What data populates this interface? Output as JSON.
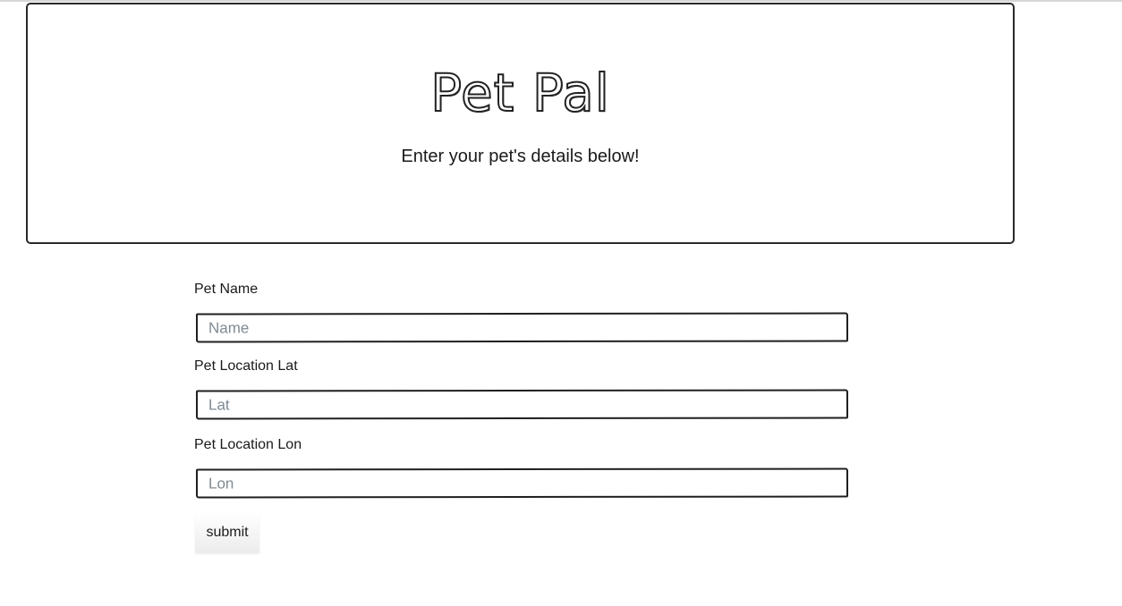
{
  "header": {
    "title": "Pet Pal",
    "subtitle": "Enter your pet's details below!"
  },
  "form": {
    "name": {
      "label": "Pet Name",
      "placeholder": "Name",
      "value": ""
    },
    "lat": {
      "label": "Pet Location Lat",
      "placeholder": "Lat",
      "value": ""
    },
    "lon": {
      "label": "Pet Location Lon",
      "placeholder": "Lon",
      "value": ""
    },
    "submit_label": "submit"
  }
}
